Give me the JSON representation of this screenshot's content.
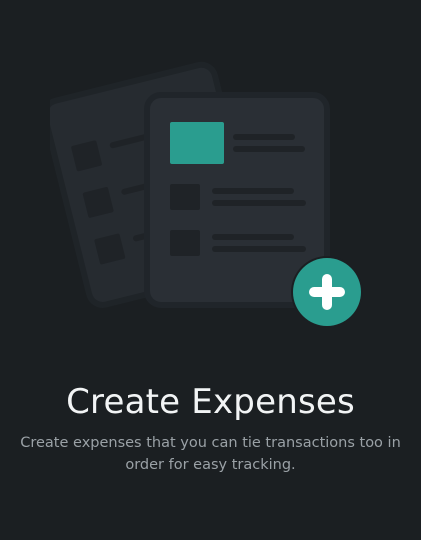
{
  "onboarding": {
    "title": "Create Expenses",
    "description": "Create expenses that you can tie transactions too in order for easy tracking."
  },
  "illustration": {
    "icon": "documents-add-icon",
    "accent_color": "#2a9d8f",
    "paper_color": "#2a2f35",
    "back_paper_color": "#262b30",
    "placeholder_color": "#1f2327"
  },
  "colors": {
    "background": "#1b1f22",
    "title": "#f2f4f5",
    "description": "#9aa1a6"
  }
}
